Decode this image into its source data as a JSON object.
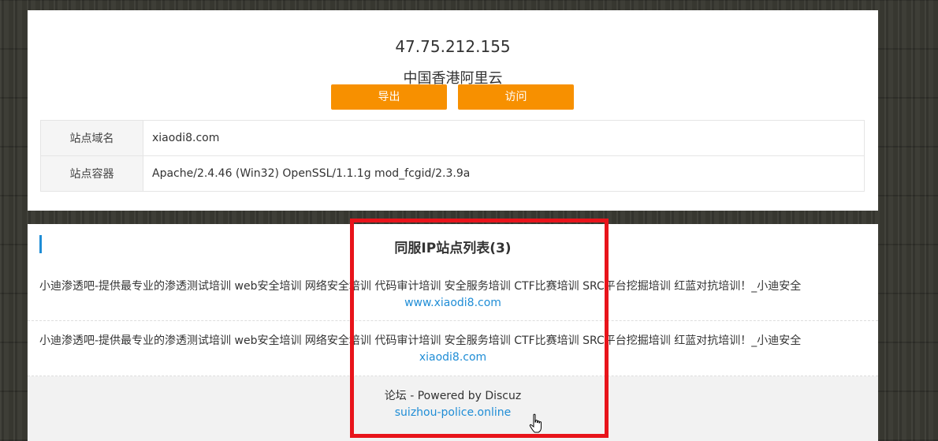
{
  "ip_info": {
    "ip": "47.75.212.155",
    "location": "中国香港阿里云",
    "export_label": "导出",
    "visit_label": "访问"
  },
  "site_table": [
    {
      "label": "站点域名",
      "value": "xiaodi8.com"
    },
    {
      "label": "站点容器",
      "value": "Apache/2.4.46 (Win32) OpenSSL/1.1.1g mod_fcgid/2.3.9a"
    }
  ],
  "same_ip": {
    "title": "同服IP站点列表(3)",
    "sites": [
      {
        "title": "小迪渗透吧-提供最专业的渗透测试培训 web安全培训 网络安全培训 代码审计培训 安全服务培训 CTF比赛培训 SRC平台挖掘培训 红蓝对抗培训！_小迪安全",
        "url": "www.xiaodi8.com"
      },
      {
        "title": "小迪渗透吧-提供最专业的渗透测试培训 web安全培训 网络安全培训 代码审计培训 安全服务培训 CTF比赛培训 SRC平台挖掘培训 红蓝对抗培训！_小迪安全",
        "url": "xiaodi8.com"
      },
      {
        "title": "论坛 - Powered by Discuz",
        "url": "suizhou-police.online"
      }
    ]
  },
  "colors": {
    "accent_orange": "#f79000",
    "link_blue": "#1f8dd6",
    "annotation_red": "#e8141b"
  }
}
